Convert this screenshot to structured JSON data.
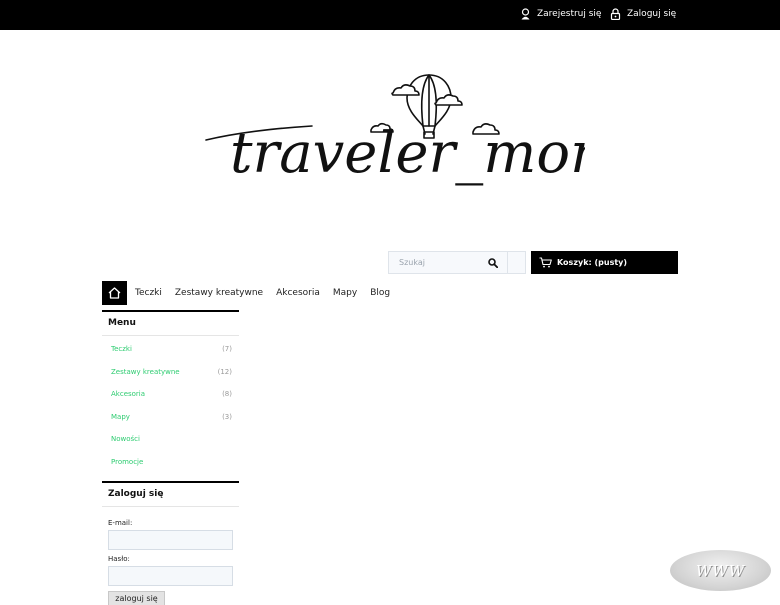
{
  "topbar": {
    "register_label": "Zarejestruj się",
    "login_label": "Zaloguj się"
  },
  "logo": {
    "text": "traveler_mom"
  },
  "search": {
    "placeholder": "Szukaj"
  },
  "cart": {
    "label": "Koszyk: (pusty)"
  },
  "nav": {
    "items": [
      {
        "label": "Teczki"
      },
      {
        "label": "Zestawy kreatywne"
      },
      {
        "label": "Akcesoria"
      },
      {
        "label": "Mapy"
      },
      {
        "label": "Blog"
      }
    ]
  },
  "menu": {
    "title": "Menu",
    "items": [
      {
        "label": "Teczki",
        "count": "(7)"
      },
      {
        "label": "Zestawy kreatywne",
        "count": "(12)"
      },
      {
        "label": "Akcesoria",
        "count": "(8)"
      },
      {
        "label": "Mapy",
        "count": "(3)"
      },
      {
        "label": "Nowości",
        "count": ""
      },
      {
        "label": "Promocje",
        "count": ""
      }
    ]
  },
  "login": {
    "title": "Zaloguj się",
    "email_label": "E-mail:",
    "password_label": "Hasło:",
    "submit_label": "zaloguj się"
  },
  "watermark": {
    "text": "WWW"
  },
  "colors": {
    "accent": "#2ecc71",
    "topbar": "#000000"
  }
}
